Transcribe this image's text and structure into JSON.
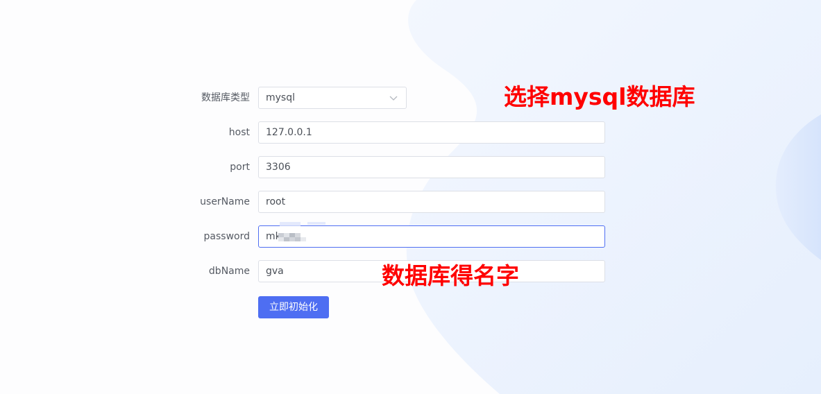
{
  "form": {
    "db_type": {
      "label": "数据库类型",
      "value": "mysql"
    },
    "host": {
      "label": "host",
      "value": "127.0.0.1"
    },
    "port": {
      "label": "port",
      "value": "3306"
    },
    "user_name": {
      "label": "userName",
      "value": "root"
    },
    "password": {
      "label": "password",
      "value": "mk"
    },
    "db_name": {
      "label": "dbName",
      "value": "gva"
    },
    "submit_label": "立即初始化"
  },
  "annotations": {
    "select_mysql": "选择mysql数据库",
    "db_name_note": "数据库得名字"
  },
  "colors": {
    "primary": "#4e6ef2",
    "annotation": "#ff0000",
    "background_shape": "#e8f0fe"
  }
}
